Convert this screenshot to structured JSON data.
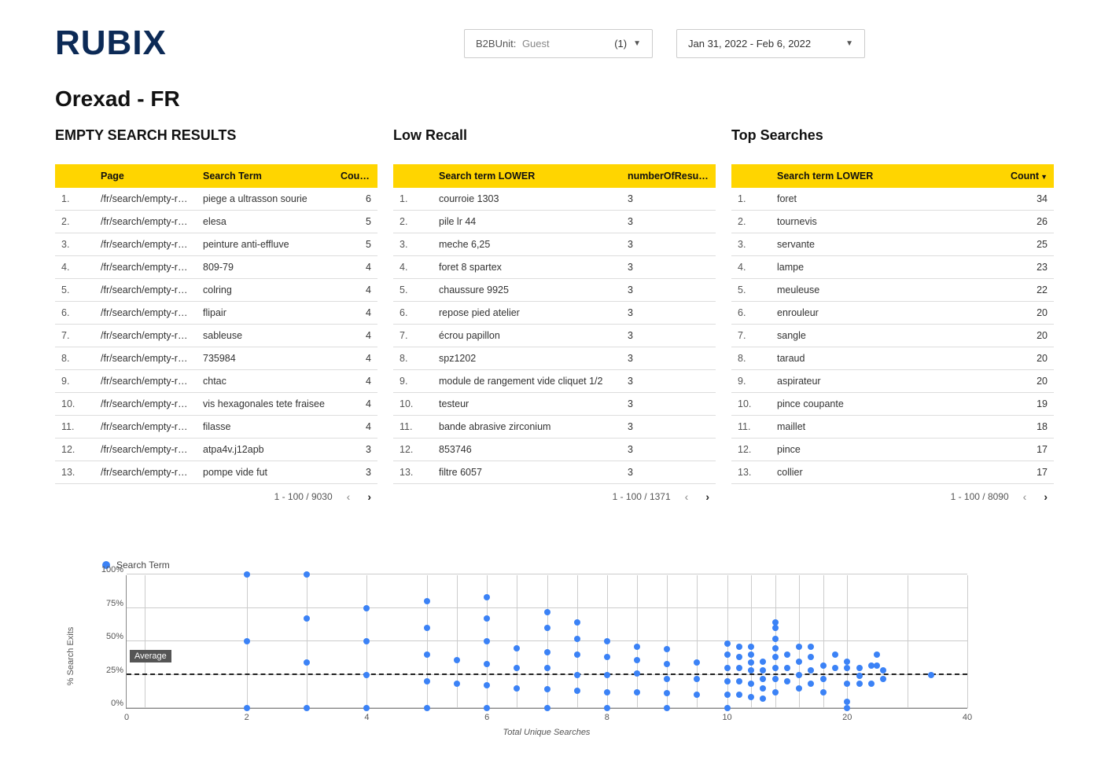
{
  "brand": "RUBIX",
  "page_title": "Orexad - FR",
  "filters": {
    "b2b_label": "B2BUnit:",
    "b2b_value": "Guest",
    "b2b_count": "(1)",
    "date_range": "Jan 31, 2022 - Feb 6, 2022"
  },
  "panels": {
    "empty": {
      "title": "EMPTY SEARCH RESULTS",
      "headers": [
        "",
        "Page",
        "Search Term",
        "Coun…"
      ],
      "page_prefix": "/fr/search/empty-res…",
      "rows": [
        {
          "idx": "1.",
          "term": "piege a ultrasson sourie",
          "count": 6
        },
        {
          "idx": "2.",
          "term": "elesa",
          "count": 5
        },
        {
          "idx": "3.",
          "term": "peinture anti-effluve",
          "count": 5
        },
        {
          "idx": "4.",
          "term": "809-79",
          "count": 4
        },
        {
          "idx": "5.",
          "term": "colring",
          "count": 4
        },
        {
          "idx": "6.",
          "term": "flipair",
          "count": 4
        },
        {
          "idx": "7.",
          "term": "sableuse",
          "count": 4
        },
        {
          "idx": "8.",
          "term": "735984",
          "count": 4
        },
        {
          "idx": "9.",
          "term": "chtac",
          "count": 4
        },
        {
          "idx": "10.",
          "term": "vis hexagonales tete fraisee",
          "count": 4
        },
        {
          "idx": "11.",
          "term": "filasse",
          "count": 4
        },
        {
          "idx": "12.",
          "term": "atpa4v.j12apb",
          "count": 3
        },
        {
          "idx": "13.",
          "term": "pompe vide fut",
          "count": 3
        }
      ],
      "pager": "1 - 100 / 9030"
    },
    "lowrecall": {
      "title": "Low Recall",
      "headers": [
        "",
        "Search term LOWER",
        "numberOfResults…"
      ],
      "rows": [
        {
          "idx": "1.",
          "term": "courroie 1303",
          "count": 3
        },
        {
          "idx": "2.",
          "term": "pile lr 44",
          "count": 3
        },
        {
          "idx": "3.",
          "term": "meche 6,25",
          "count": 3
        },
        {
          "idx": "4.",
          "term": "foret 8 spartex",
          "count": 3
        },
        {
          "idx": "5.",
          "term": "chaussure 9925",
          "count": 3
        },
        {
          "idx": "6.",
          "term": "repose pied atelier",
          "count": 3
        },
        {
          "idx": "7.",
          "term": "écrou papillon",
          "count": 3
        },
        {
          "idx": "8.",
          "term": "spz1202",
          "count": 3
        },
        {
          "idx": "9.",
          "term": "module de rangement vide cliquet 1/2",
          "count": 3
        },
        {
          "idx": "10.",
          "term": "testeur",
          "count": 3
        },
        {
          "idx": "11.",
          "term": "bande abrasive zirconium",
          "count": 3
        },
        {
          "idx": "12.",
          "term": "853746",
          "count": 3
        },
        {
          "idx": "13.",
          "term": "filtre 6057",
          "count": 3
        }
      ],
      "pager": "1 - 100 / 1371"
    },
    "top": {
      "title": "Top Searches",
      "headers": [
        "",
        "Search term LOWER",
        "Count"
      ],
      "rows": [
        {
          "idx": "1.",
          "term": "foret",
          "count": 34
        },
        {
          "idx": "2.",
          "term": "tournevis",
          "count": 26
        },
        {
          "idx": "3.",
          "term": "servante",
          "count": 25
        },
        {
          "idx": "4.",
          "term": "lampe",
          "count": 23
        },
        {
          "idx": "5.",
          "term": "meuleuse",
          "count": 22
        },
        {
          "idx": "6.",
          "term": "enrouleur",
          "count": 20
        },
        {
          "idx": "7.",
          "term": "sangle",
          "count": 20
        },
        {
          "idx": "8.",
          "term": "taraud",
          "count": 20
        },
        {
          "idx": "9.",
          "term": "aspirateur",
          "count": 20
        },
        {
          "idx": "10.",
          "term": "pince coupante",
          "count": 19
        },
        {
          "idx": "11.",
          "term": "maillet",
          "count": 18
        },
        {
          "idx": "12.",
          "term": "pince",
          "count": 17
        },
        {
          "idx": "13.",
          "term": "collier",
          "count": 17
        }
      ],
      "pager": "1 - 100 / 8090"
    }
  },
  "chart_data": {
    "type": "scatter",
    "legend": "Search Term",
    "xlabel": "Total Unique Searches",
    "ylabel": "% Search Exits",
    "xticks": [
      0,
      2,
      4,
      6,
      8,
      10,
      20,
      40
    ],
    "yticks": [
      0,
      25,
      50,
      75,
      100
    ],
    "ytick_labels": [
      "0%",
      "25%",
      "50%",
      "75%",
      "100%"
    ],
    "average_label": "Average",
    "average_y": 25,
    "vgrid_x": [
      0.3,
      2,
      3,
      4,
      5,
      5.5,
      6,
      6.5,
      7,
      7.5,
      8,
      8.5,
      9,
      9.5,
      10,
      12,
      14,
      16,
      18,
      20,
      30,
      40
    ],
    "points": [
      [
        2,
        0
      ],
      [
        2,
        50
      ],
      [
        2,
        100
      ],
      [
        3,
        0
      ],
      [
        3,
        34
      ],
      [
        3,
        67
      ],
      [
        3,
        100
      ],
      [
        4,
        0
      ],
      [
        4,
        25
      ],
      [
        4,
        50
      ],
      [
        4,
        75
      ],
      [
        5,
        0
      ],
      [
        5,
        20
      ],
      [
        5,
        40
      ],
      [
        5,
        60
      ],
      [
        5,
        80
      ],
      [
        5.5,
        18
      ],
      [
        5.5,
        36
      ],
      [
        6,
        0
      ],
      [
        6,
        17
      ],
      [
        6,
        33
      ],
      [
        6,
        50
      ],
      [
        6,
        67
      ],
      [
        6,
        83
      ],
      [
        6.5,
        15
      ],
      [
        6.5,
        30
      ],
      [
        6.5,
        45
      ],
      [
        7,
        0
      ],
      [
        7,
        14
      ],
      [
        7,
        30
      ],
      [
        7,
        42
      ],
      [
        7,
        60
      ],
      [
        7,
        72
      ],
      [
        7.5,
        13
      ],
      [
        7.5,
        25
      ],
      [
        7.5,
        40
      ],
      [
        7.5,
        52
      ],
      [
        7.5,
        64
      ],
      [
        8,
        0
      ],
      [
        8,
        12
      ],
      [
        8,
        25
      ],
      [
        8,
        38
      ],
      [
        8,
        50
      ],
      [
        8.5,
        12
      ],
      [
        8.5,
        26
      ],
      [
        8.5,
        36
      ],
      [
        8.5,
        46
      ],
      [
        9,
        0
      ],
      [
        9,
        11
      ],
      [
        9,
        22
      ],
      [
        9,
        33
      ],
      [
        9,
        44
      ],
      [
        9.5,
        10
      ],
      [
        9.5,
        22
      ],
      [
        9.5,
        34
      ],
      [
        10,
        0
      ],
      [
        10,
        10
      ],
      [
        10,
        20
      ],
      [
        10,
        30
      ],
      [
        10,
        40
      ],
      [
        10,
        48
      ],
      [
        11,
        10
      ],
      [
        11,
        20
      ],
      [
        11,
        30
      ],
      [
        11,
        38
      ],
      [
        11,
        46
      ],
      [
        12,
        8
      ],
      [
        12,
        18
      ],
      [
        12,
        28
      ],
      [
        12,
        34
      ],
      [
        12,
        40
      ],
      [
        12,
        46
      ],
      [
        13,
        7
      ],
      [
        13,
        15
      ],
      [
        13,
        22
      ],
      [
        13,
        28
      ],
      [
        13,
        35
      ],
      [
        14,
        12
      ],
      [
        14,
        22
      ],
      [
        14,
        30
      ],
      [
        14,
        38
      ],
      [
        14,
        45
      ],
      [
        14,
        52
      ],
      [
        14,
        60
      ],
      [
        14,
        64
      ],
      [
        15,
        20
      ],
      [
        15,
        30
      ],
      [
        15,
        40
      ],
      [
        16,
        15
      ],
      [
        16,
        25
      ],
      [
        16,
        35
      ],
      [
        16,
        46
      ],
      [
        17,
        18
      ],
      [
        17,
        28
      ],
      [
        17,
        38
      ],
      [
        17,
        46
      ],
      [
        18,
        12
      ],
      [
        18,
        22
      ],
      [
        18,
        32
      ],
      [
        19,
        30
      ],
      [
        19,
        40
      ],
      [
        20,
        0
      ],
      [
        20,
        5
      ],
      [
        20,
        18
      ],
      [
        20,
        30
      ],
      [
        20,
        35
      ],
      [
        22,
        18
      ],
      [
        22,
        24
      ],
      [
        22,
        30
      ],
      [
        24,
        18
      ],
      [
        24,
        32
      ],
      [
        25,
        32
      ],
      [
        25,
        40
      ],
      [
        26,
        22
      ],
      [
        26,
        28
      ],
      [
        34,
        25
      ]
    ]
  }
}
